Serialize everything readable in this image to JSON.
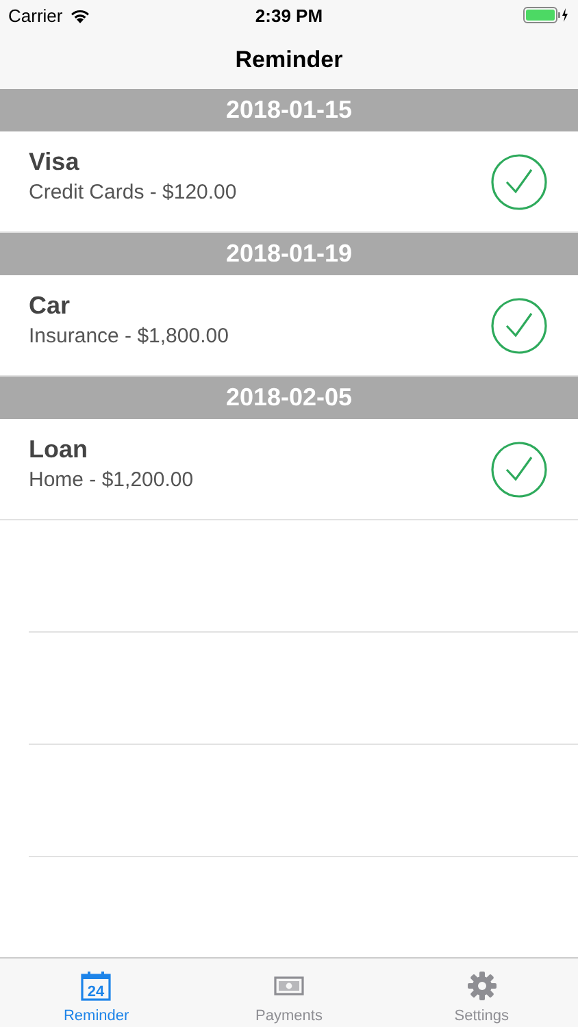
{
  "status_bar": {
    "carrier": "Carrier",
    "time": "2:39 PM"
  },
  "nav": {
    "title": "Reminder"
  },
  "sections": [
    {
      "date": "2018-01-15",
      "items": [
        {
          "title": "Visa",
          "detail": "Credit Cards - $120.00",
          "checked": true
        }
      ]
    },
    {
      "date": "2018-01-19",
      "items": [
        {
          "title": "Car",
          "detail": "Insurance - $1,800.00",
          "checked": true
        }
      ]
    },
    {
      "date": "2018-02-05",
      "items": [
        {
          "title": "Loan",
          "detail": "Home - $1,200.00",
          "checked": true
        }
      ]
    }
  ],
  "tabs": [
    {
      "label": "Reminder",
      "kind": "calendar",
      "icon_text": "24",
      "selected": true
    },
    {
      "label": "Payments",
      "kind": "money",
      "selected": false
    },
    {
      "label": "Settings",
      "kind": "gear",
      "selected": false
    }
  ]
}
